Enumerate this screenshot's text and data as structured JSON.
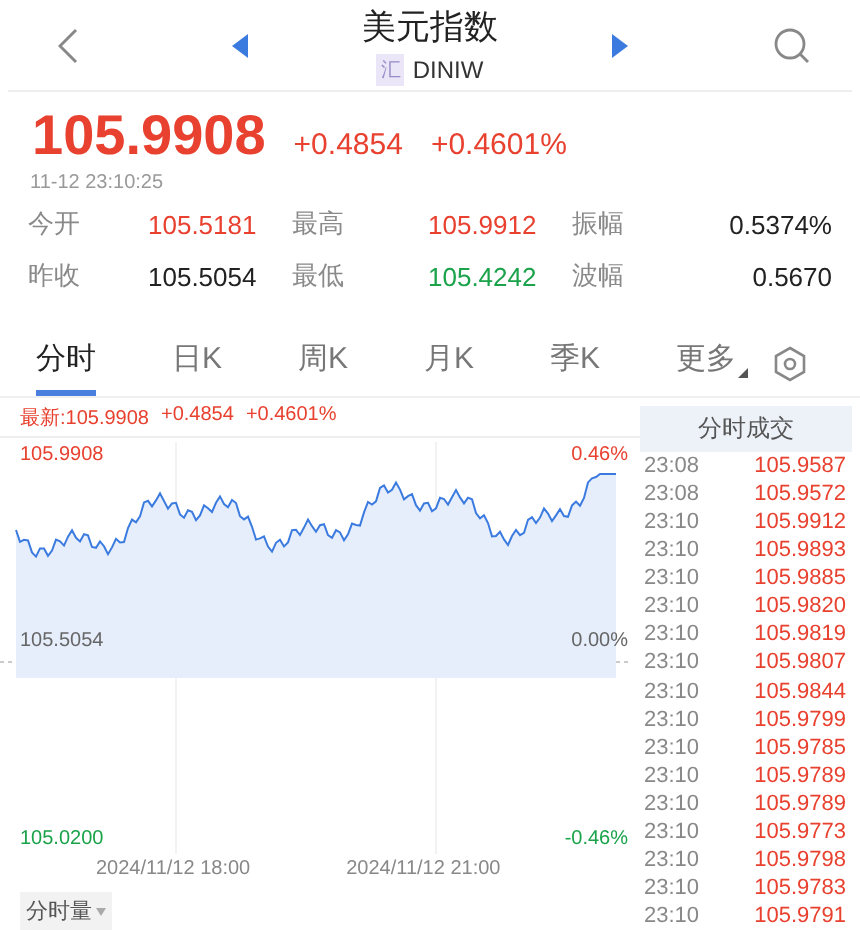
{
  "header": {
    "title": "美元指数",
    "badge": "汇",
    "code": "DINIW"
  },
  "quote": {
    "price": "105.9908",
    "change": "+0.4854",
    "change_pct": "+0.4601%",
    "time": "11-12 23:10:25"
  },
  "stats": [
    {
      "label": "今开",
      "value": "105.5181",
      "color": "#e8412f"
    },
    {
      "label": "最高",
      "value": "105.9912",
      "color": "#e8412f"
    },
    {
      "label": "振幅",
      "value": "0.5374%",
      "color": "#222222"
    },
    {
      "label": "昨收",
      "value": "105.5054",
      "color": "#222222"
    },
    {
      "label": "最低",
      "value": "105.4242",
      "color": "#1aa34a"
    },
    {
      "label": "波幅",
      "value": "0.5670",
      "color": "#222222"
    }
  ],
  "tabs": [
    {
      "label": "分时",
      "selected": true
    },
    {
      "label": "日K",
      "selected": false
    },
    {
      "label": "周K",
      "selected": false
    },
    {
      "label": "月K",
      "selected": false
    },
    {
      "label": "季K",
      "selected": false
    },
    {
      "label": "更多",
      "selected": false
    }
  ],
  "chart": {
    "latest": "最新:105.9908",
    "latest_change": "+0.4854",
    "latest_pct": "+0.4601%",
    "top_price": "105.9908",
    "top_pct": "0.46%",
    "mid_price": "105.5054",
    "mid_pct": "0.00%",
    "bottom_price": "105.0200",
    "bottom_pct": "-0.46%",
    "times": [
      "2024/11/12 18:00",
      "2024/11/12 21:00"
    ],
    "volume_button": "分时量"
  },
  "trades": {
    "title": "分时成交",
    "rows": [
      {
        "time": "23:08",
        "price": "105.9587"
      },
      {
        "time": "23:08",
        "price": "105.9572"
      },
      {
        "time": "23:10",
        "price": "105.9912"
      },
      {
        "time": "23:10",
        "price": "105.9893"
      },
      {
        "time": "23:10",
        "price": "105.9885"
      },
      {
        "time": "23:10",
        "price": "105.9820"
      },
      {
        "time": "23:10",
        "price": "105.9819"
      },
      {
        "time": "23:10",
        "price": "105.9807"
      },
      {
        "time": "23:10",
        "price": "105.9844"
      },
      {
        "time": "23:10",
        "price": "105.9799"
      },
      {
        "time": "23:10",
        "price": "105.9785"
      },
      {
        "time": "23:10",
        "price": "105.9789"
      },
      {
        "time": "23:10",
        "price": "105.9789"
      },
      {
        "time": "23:10",
        "price": "105.9773"
      },
      {
        "time": "23:10",
        "price": "105.9798"
      },
      {
        "time": "23:10",
        "price": "105.9783"
      },
      {
        "time": "23:10",
        "price": "105.9791"
      }
    ]
  }
}
